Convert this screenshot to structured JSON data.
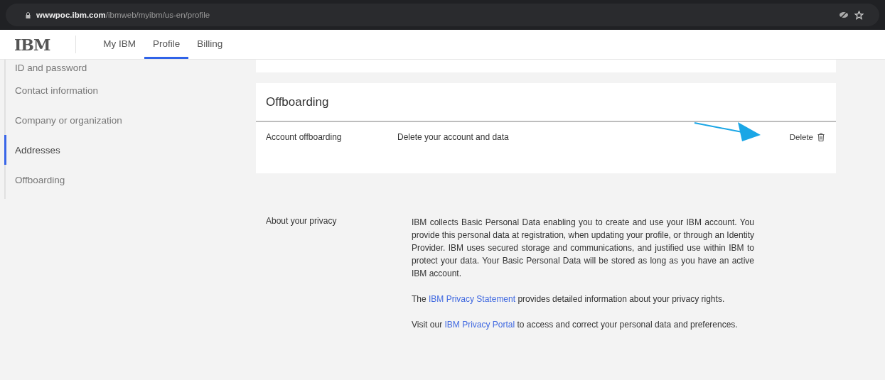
{
  "browser": {
    "url_host": "wwwpoc.ibm.com",
    "url_path": "/ibmweb/myibm/us-en/profile"
  },
  "header": {
    "logo": "IBM",
    "tabs": [
      {
        "label": "My IBM",
        "selected": false
      },
      {
        "label": "Profile",
        "selected": true
      },
      {
        "label": "Billing",
        "selected": false
      }
    ]
  },
  "sidebar": {
    "items": [
      {
        "label": "ID and password",
        "selected": false
      },
      {
        "label": "Contact information",
        "selected": false
      },
      {
        "label": "Company or organization",
        "selected": false
      },
      {
        "label": "Addresses",
        "selected": true
      },
      {
        "label": "Offboarding",
        "selected": false
      }
    ]
  },
  "offboarding": {
    "title": "Offboarding",
    "rows": [
      {
        "label": "Account offboarding",
        "description": "Delete your account and data",
        "action": "Delete"
      }
    ]
  },
  "privacy": {
    "label": "About your privacy",
    "paragraphs": [
      {
        "before": "IBM collects Basic Personal Data enabling you to create and use your IBM account. You provide this personal data at registration, when updating your profile, or through an Identity Provider. IBM uses secured storage and communications, and justified use within IBM to protect your data. Your Basic Personal Data will be stored as long as you have an active IBM account."
      },
      {
        "before": "The ",
        "link": "IBM Privacy Statement",
        "after": " provides detailed information about your privacy rights."
      },
      {
        "before": "Visit our ",
        "link": "IBM Privacy Portal",
        "after": " to access and correct your personal data and preferences."
      }
    ]
  }
}
